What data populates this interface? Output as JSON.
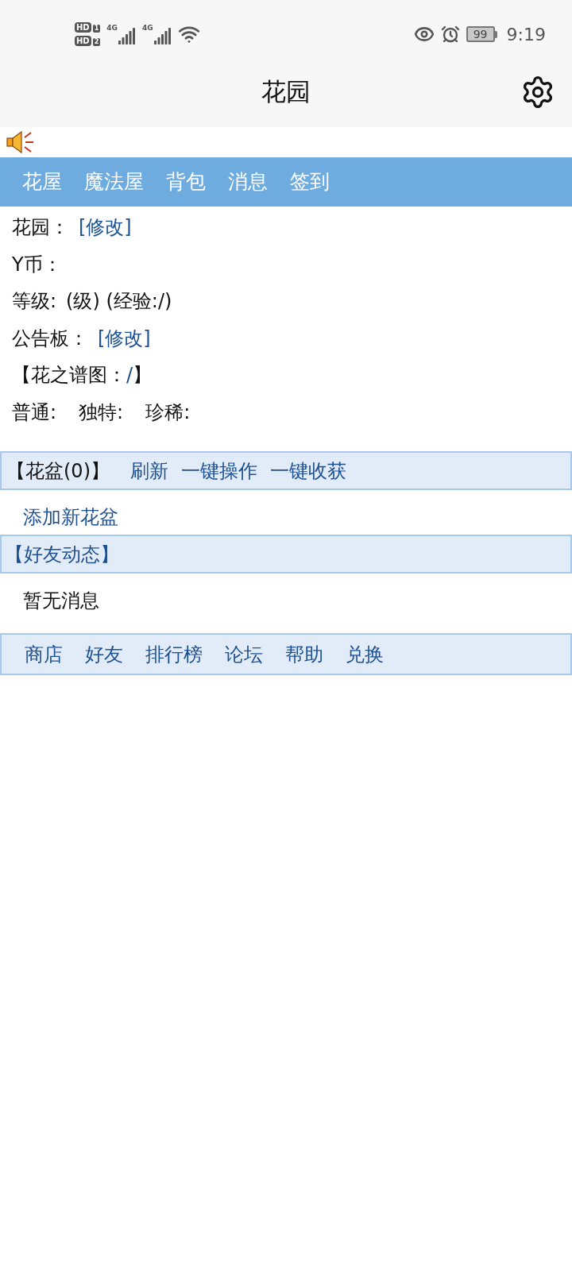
{
  "status_bar": {
    "sims": [
      {
        "label": "HD",
        "slot": "1"
      },
      {
        "label": "HD",
        "slot": "2"
      }
    ],
    "networks": [
      "4G",
      "4G"
    ],
    "battery": "99",
    "time": "9:19"
  },
  "header": {
    "title": "花园"
  },
  "nav": [
    "花屋",
    "魔法屋",
    "背包",
    "消息",
    "签到"
  ],
  "info_lines": [
    {
      "kind": "field",
      "parts": [
        {
          "kind": "text",
          "text": "花园："
        },
        {
          "kind": "link",
          "text": "[修改]"
        }
      ]
    },
    {
      "kind": "field",
      "parts": [
        {
          "kind": "text",
          "text": "Y币："
        }
      ]
    },
    {
      "kind": "field",
      "parts": [
        {
          "kind": "text",
          "text": "等级:"
        },
        {
          "kind": "text",
          "text": "(级) (经验:/)"
        }
      ]
    },
    {
      "kind": "field",
      "parts": [
        {
          "kind": "text",
          "text": "公告板："
        },
        {
          "kind": "link",
          "text": "[修改]"
        }
      ]
    },
    {
      "kind": "bracket",
      "parts": [
        {
          "kind": "text",
          "text": "【花之谱图："
        },
        {
          "kind": "link",
          "text": "/"
        },
        {
          "kind": "text",
          "text": "】"
        }
      ]
    },
    {
      "kind": "counts",
      "parts": [
        {
          "kind": "text",
          "text": "普通:"
        },
        {
          "kind": "text",
          "text": "独特:"
        },
        {
          "kind": "text",
          "text": "珍稀:"
        }
      ]
    }
  ],
  "pots": {
    "title": "【花盆(0)】",
    "actions": [
      "刷新",
      "一键操作",
      "一键收获"
    ],
    "add_link": "添加新花盆"
  },
  "friend_feed": {
    "title": "【好友动态】",
    "empty_text": "暂无消息"
  },
  "footer_links": [
    "商店",
    "好友",
    "排行榜",
    "论坛",
    "帮助",
    "兑换"
  ]
}
